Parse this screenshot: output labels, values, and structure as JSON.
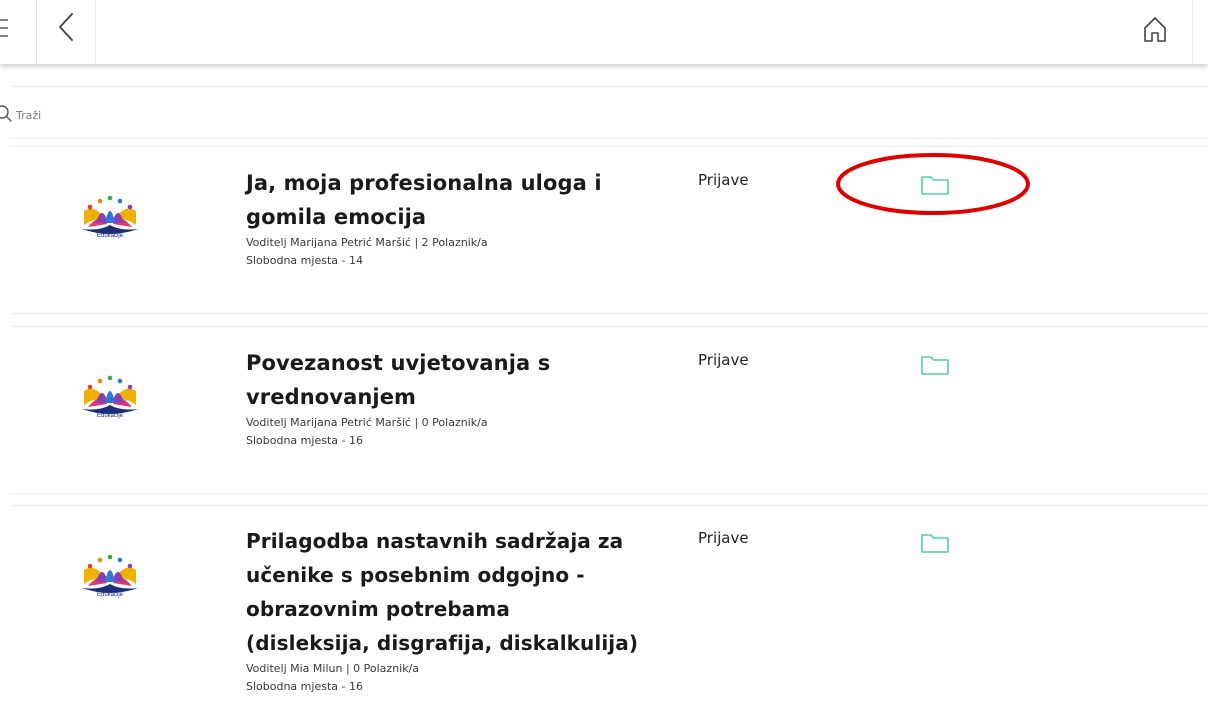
{
  "search": {
    "placeholder": "Traži"
  },
  "courses": [
    {
      "title_line1": "Ja, moja profesionalna uloga i",
      "title_line2": "gomila emocija",
      "title_line3": "",
      "title_line4": "",
      "leader": "Voditelj Marijana Petrić Maršić | 2 Polaznik/a",
      "free_seats": "Slobodna mjesta - 14",
      "registrations_label": "Prijave",
      "logo_caption": "Edukacije"
    },
    {
      "title_line1": "Povezanost uvjetovanja s",
      "title_line2": "vrednovanjem",
      "title_line3": "",
      "title_line4": "",
      "leader": "Voditelj Marijana Petrić Maršić | 0 Polaznik/a",
      "free_seats": "Slobodna mjesta - 16",
      "registrations_label": "Prijave",
      "logo_caption": "Edukacije"
    },
    {
      "title_line1": "Prilagodba nastavnih sadržaja za",
      "title_line2": "učenike s posebnim odgojno -",
      "title_line3": "obrazovnim potrebama",
      "title_line4": "(disleksija, disgrafija, diskalkulija)",
      "leader": "Voditelj Mia Milun | 0 Polaznik/a",
      "free_seats": "Slobodna mjesta - 16",
      "registrations_label": "Prijave",
      "logo_caption": "Edukacije"
    }
  ],
  "colors": {
    "folder_icon": "#4fd1a5",
    "highlight_annotation": "#e00000"
  },
  "icons": [
    "menu-icon",
    "back-arrow-icon",
    "home-icon",
    "search-icon",
    "folder-icon",
    "edukacije-logo"
  ]
}
